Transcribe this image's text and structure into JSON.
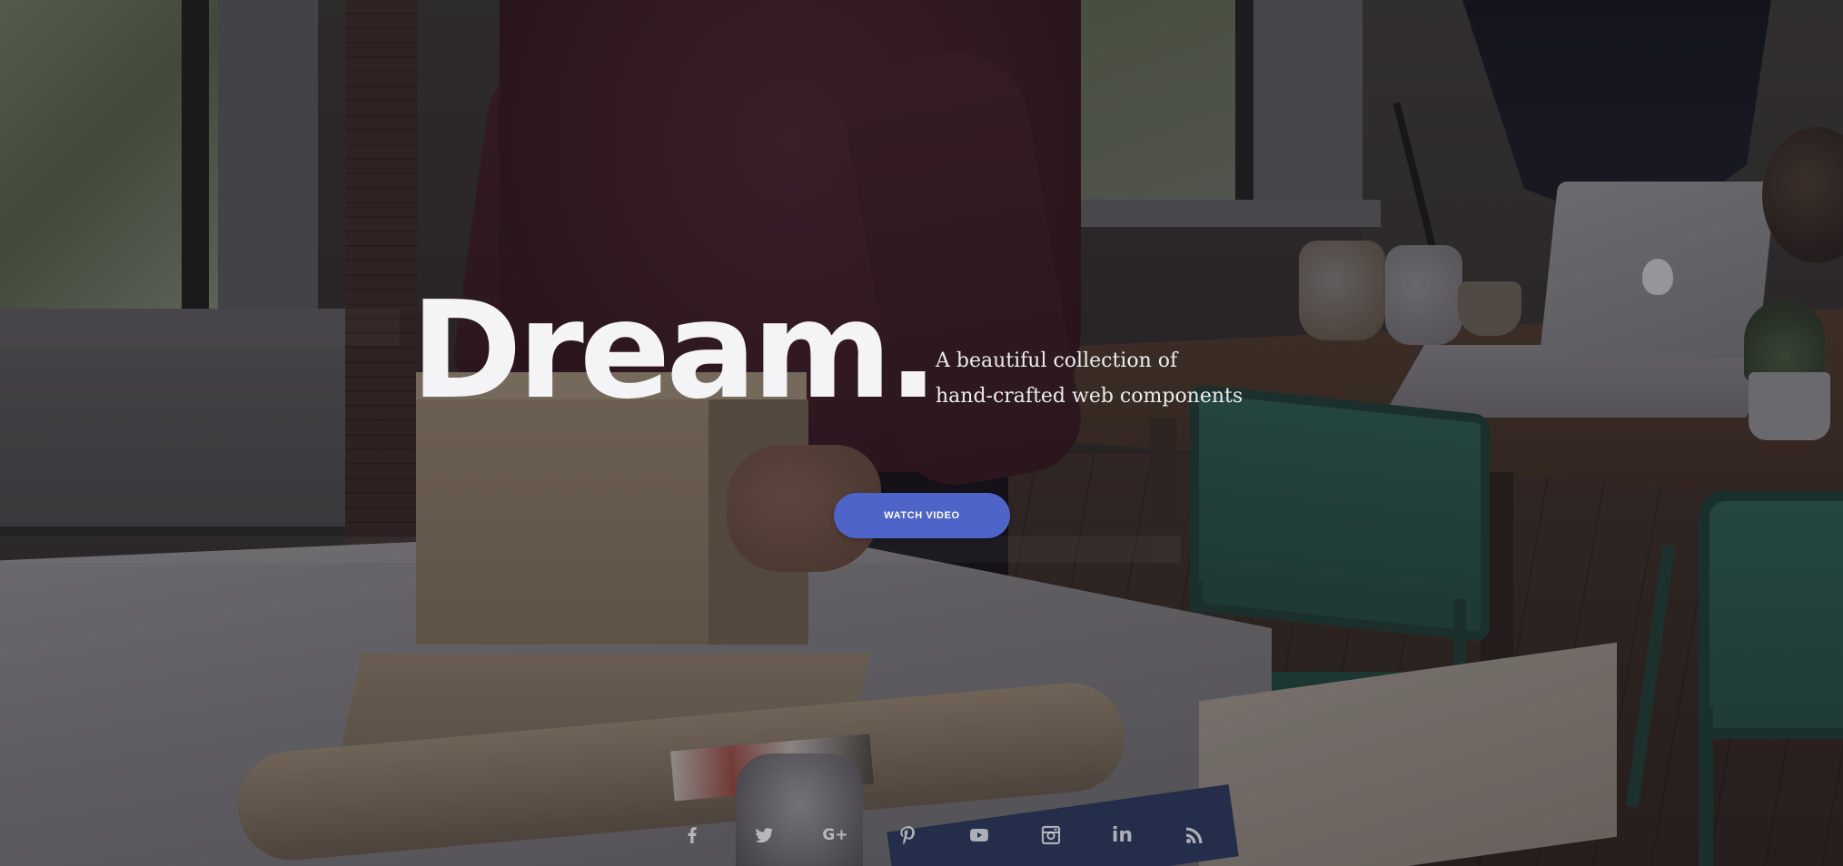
{
  "hero": {
    "title": "Dream.",
    "subtitle_lines": [
      "A beautiful collection of",
      "hand-crafted web components"
    ],
    "cta_label": "WATCH VIDEO",
    "accent_color": "#4f64c8"
  },
  "background": {
    "photo_colors": {
      "shirt": "#3b1c26",
      "cardboard": "#8f7f6a",
      "chair": "#2c5a4f",
      "wood": "#4d3b2e"
    }
  },
  "social_links": [
    {
      "icon": "facebook-icon"
    },
    {
      "icon": "twitter-icon"
    },
    {
      "icon": "google-plus-icon",
      "glyph": "G+"
    },
    {
      "icon": "pinterest-icon"
    },
    {
      "icon": "youtube-icon"
    },
    {
      "icon": "instagram-icon"
    },
    {
      "icon": "linkedin-icon",
      "glyph": "in"
    },
    {
      "icon": "rss-icon"
    }
  ],
  "social_icon_color": "#d2d2d7"
}
